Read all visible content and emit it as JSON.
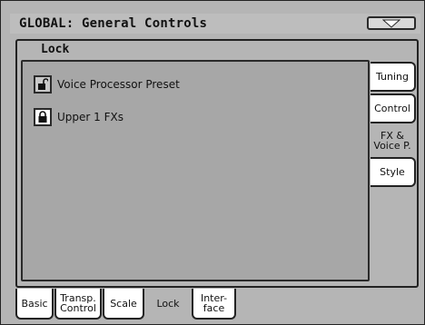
{
  "header": {
    "title": "GLOBAL: General Controls"
  },
  "panel": {
    "title": "Lock"
  },
  "locks": [
    {
      "label": "Voice Processor Preset",
      "state": "unlocked"
    },
    {
      "label": "Upper 1 FXs",
      "state": "locked"
    }
  ],
  "side_tabs": [
    {
      "label": "Tuning"
    },
    {
      "label": "Control"
    },
    {
      "line1": "FX &",
      "line2": "Voice P.",
      "selected": true
    },
    {
      "label": "Style"
    }
  ],
  "bottom_tabs": [
    {
      "label": "Basic"
    },
    {
      "line1": "Transp.",
      "line2": "Control"
    },
    {
      "label": "Scale"
    },
    {
      "label": "Lock",
      "selected": true
    },
    {
      "line1": "Inter-",
      "line2": "face"
    }
  ],
  "icons": {
    "menu": "triangle-down-icon",
    "lock_open": "unlocked-padlock-icon",
    "lock_closed": "locked-padlock-icon"
  },
  "colors": {
    "background": "#b5b5b5",
    "inner": "#a7a7a7",
    "tab": "#ffffff"
  }
}
